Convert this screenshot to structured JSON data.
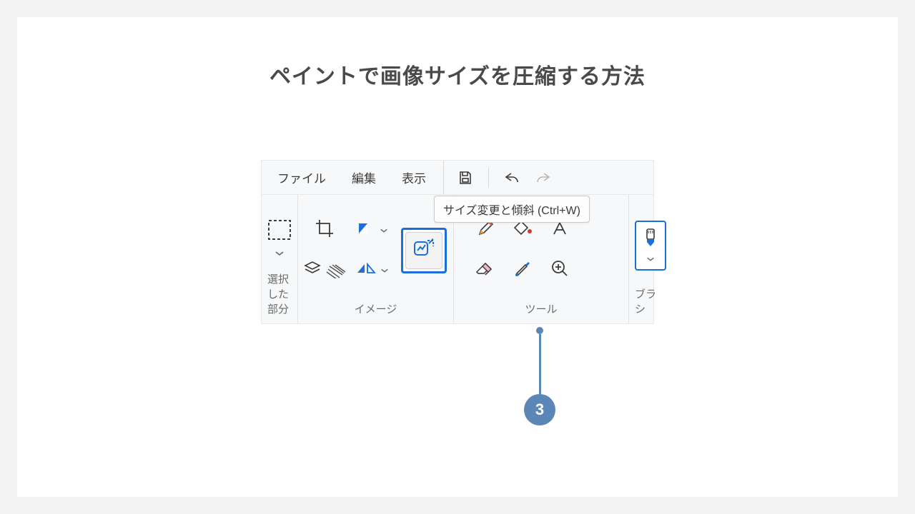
{
  "title": "ペイントで画像サイズを圧縮する方法",
  "menu": {
    "file": "ファイル",
    "edit": "編集",
    "view": "表示"
  },
  "tooltip": "サイズ変更と傾斜 (Ctrl+W)",
  "groups": {
    "selection": "選択した部分",
    "image": "イメージ",
    "tools": "ツール",
    "brush": "ブラシ"
  },
  "callout": {
    "number": "3"
  },
  "colors": {
    "accent": "#1a6fd8",
    "callout": "#5b87b6"
  }
}
